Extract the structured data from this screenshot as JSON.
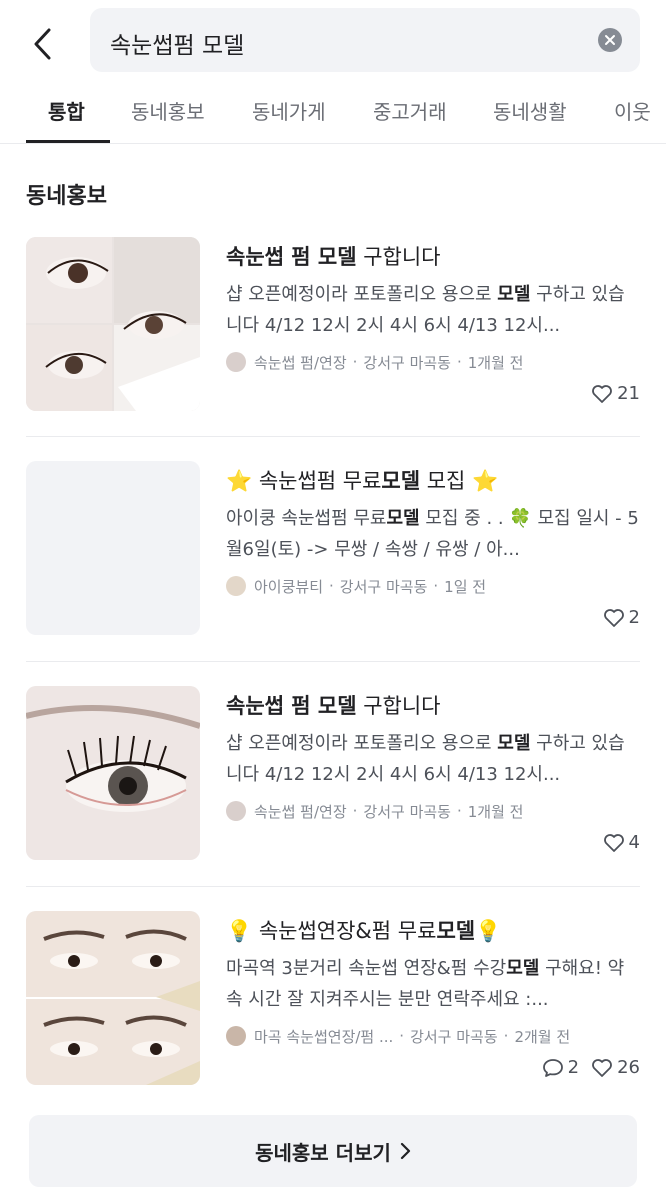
{
  "search": {
    "query": "속눈썹펌 모델"
  },
  "tabs": [
    {
      "label": "통합",
      "active": true
    },
    {
      "label": "동네홍보",
      "active": false
    },
    {
      "label": "동네가게",
      "active": false
    },
    {
      "label": "중고거래",
      "active": false
    },
    {
      "label": "동네생활",
      "active": false
    },
    {
      "label": "이웃",
      "active": false
    }
  ],
  "section": {
    "title": "동네홍보",
    "more_label": "동네홍보 더보기"
  },
  "posts": [
    {
      "title_parts": [
        {
          "text": "속눈썹 펌 모델",
          "bold": true
        },
        {
          "text": " 구합니다",
          "bold": false
        }
      ],
      "body_parts": [
        {
          "text": "샵 오픈예정이라 포토폴리오 용으로 ",
          "bold": false
        },
        {
          "text": "모델",
          "bold": true
        },
        {
          "text": " 구하고 있습니다 4/12 12시 2시 4시 6시 4/13 12시...",
          "bold": false
        }
      ],
      "author": "속눈썹 펌/연장",
      "location": "강서구 마곡동",
      "time": "1개월 전",
      "comments": null,
      "likes": "21",
      "thumb": "eyelash-collage"
    },
    {
      "title_parts": [
        {
          "text": "⭐ 속눈썹펌 무료",
          "bold": false
        },
        {
          "text": "모델",
          "bold": true
        },
        {
          "text": " 모집 ⭐",
          "bold": false
        }
      ],
      "body_parts": [
        {
          "text": "아이쿵 속눈썹펌 무료",
          "bold": false
        },
        {
          "text": "모델",
          "bold": true
        },
        {
          "text": " 모집 중 . . 🍀 모집 일시  - 5월6일(토) -> 무쌍 / 속쌍 / 유쌍 / 아...",
          "bold": false
        }
      ],
      "author": "아이쿵뷰티",
      "location": "강서구 마곡동",
      "time": "1일 전",
      "comments": null,
      "likes": "2",
      "thumb": "blank"
    },
    {
      "title_parts": [
        {
          "text": "속눈썹 펌 모델",
          "bold": true
        },
        {
          "text": " 구합니다",
          "bold": false
        }
      ],
      "body_parts": [
        {
          "text": "샵 오픈예정이라 포토폴리오 용으로 ",
          "bold": false
        },
        {
          "text": "모델",
          "bold": true
        },
        {
          "text": " 구하고 있습니다 4/12 12시 2시 4시 6시 4/13 12시...",
          "bold": false
        }
      ],
      "author": "속눈썹 펌/연장",
      "location": "강서구 마곡동",
      "time": "1개월 전",
      "comments": null,
      "likes": "4",
      "thumb": "eyelash-closeup"
    },
    {
      "title_parts": [
        {
          "text": "💡 속눈썹연장&펌 무료",
          "bold": false
        },
        {
          "text": "모델",
          "bold": true
        },
        {
          "text": "💡",
          "bold": false
        }
      ],
      "body_parts": [
        {
          "text": "마곡역 3분거리 속눈썹 연장&펌 수강",
          "bold": false
        },
        {
          "text": "모델",
          "bold": true
        },
        {
          "text": " 구해요! 약속 시간 잘 지켜주시는 분만 연락주세요 :...",
          "bold": false
        }
      ],
      "author": "마곡 속눈썹연장/펌 ...",
      "location": "강서구 마곡동",
      "time": "2개월 전",
      "comments": "2",
      "likes": "26",
      "thumb": "eyes-stacked"
    }
  ],
  "colors": {
    "text_primary": "#212124",
    "text_secondary": "#868b94",
    "surface": "#f2f3f6",
    "divider": "#eaebee"
  }
}
